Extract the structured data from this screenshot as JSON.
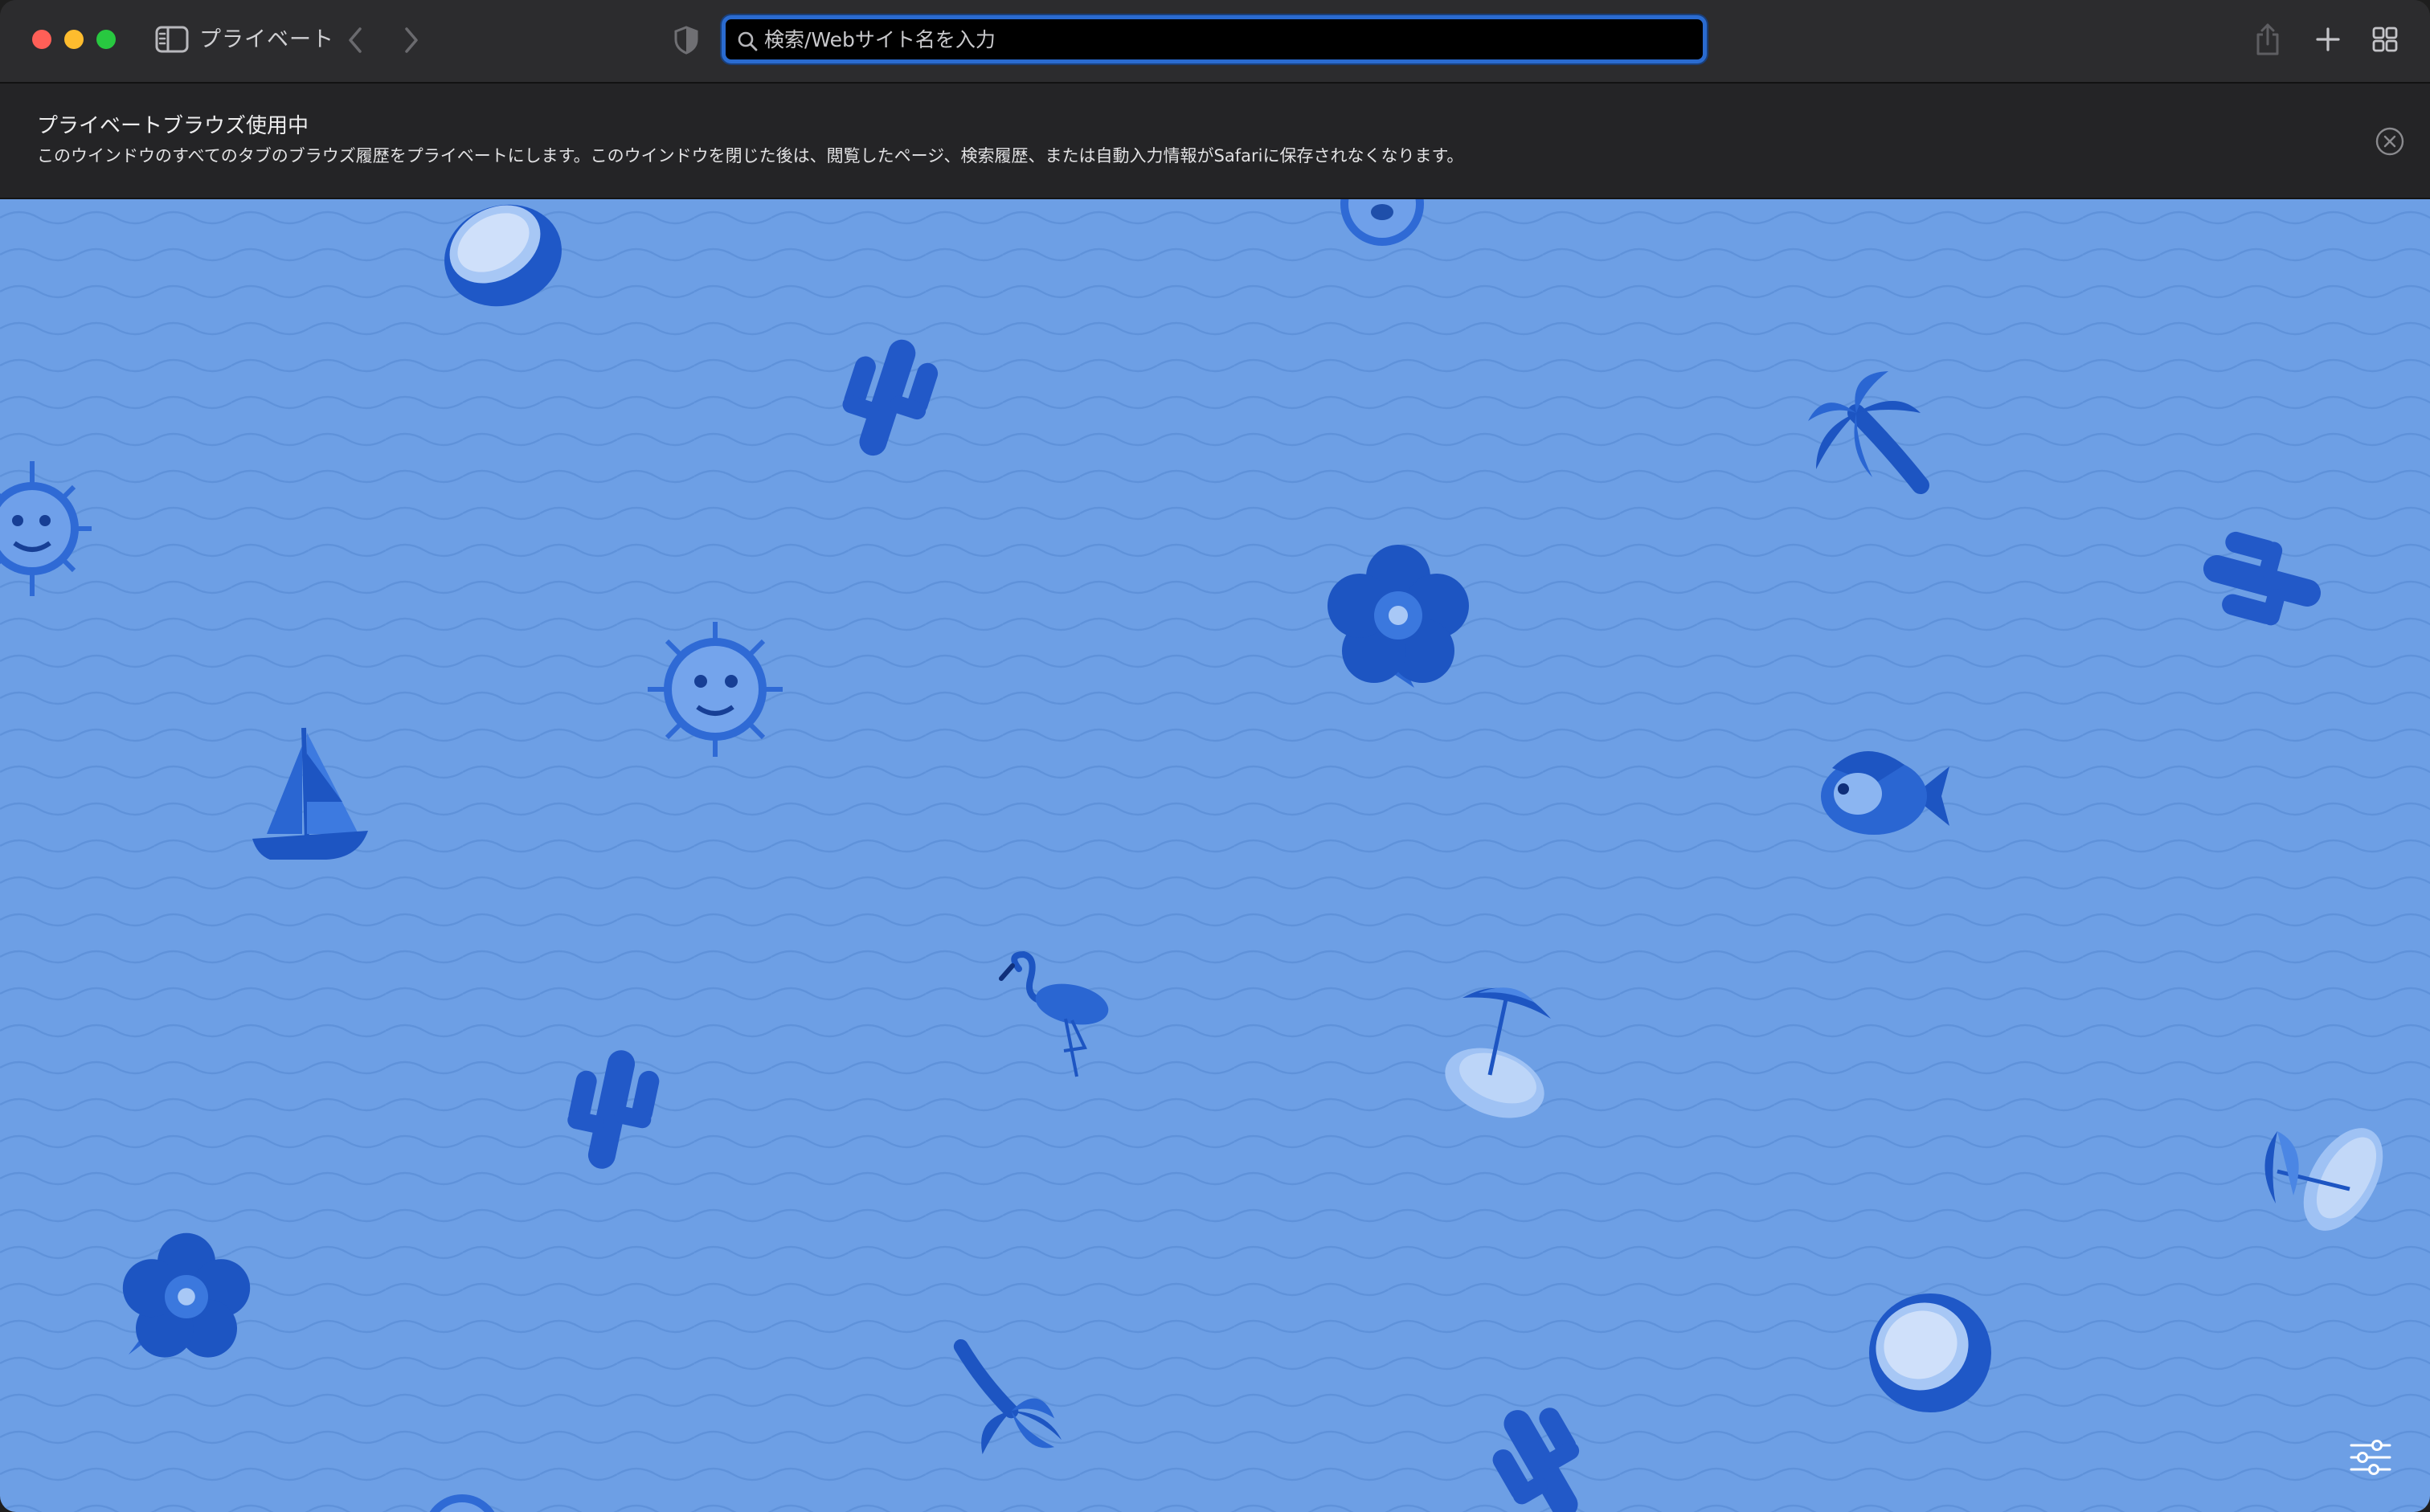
{
  "toolbar": {
    "private_label": "プライベート",
    "search": {
      "placeholder": "検索/Webサイト名を入力",
      "value": ""
    }
  },
  "banner": {
    "title": "プライベートブラウズ使用中",
    "text": "このウインドウのすべてのタブのブラウズ履歴をプライベートにします。このウインドウを閉じた後は、閲覧したページ、検索履歴、または自動入力情報がSafariに保存されなくなります。"
  },
  "colors": {
    "toolbar_bg": "#2c2c2e",
    "banner_bg": "#242426",
    "content_bg": "#6d9fe5",
    "accent": "#2a6bd0",
    "emoji_dark": "#1f58c7",
    "emoji_light": "#9fc2f4"
  },
  "icons": [
    "sidebar-icon",
    "chevron-left-icon",
    "chevron-right-icon",
    "privacy-shield-icon",
    "search-icon",
    "share-icon",
    "plus-icon",
    "tab-overview-icon",
    "close-circle-icon",
    "sliders-icon"
  ],
  "decorations": [
    "coconut-icon",
    "sun-face-icon",
    "cactus-icon",
    "palm-tree-icon",
    "hibiscus-icon",
    "sailboat-icon",
    "tropical-fish-icon",
    "flamingo-icon",
    "beach-umbrella-island-icon"
  ]
}
